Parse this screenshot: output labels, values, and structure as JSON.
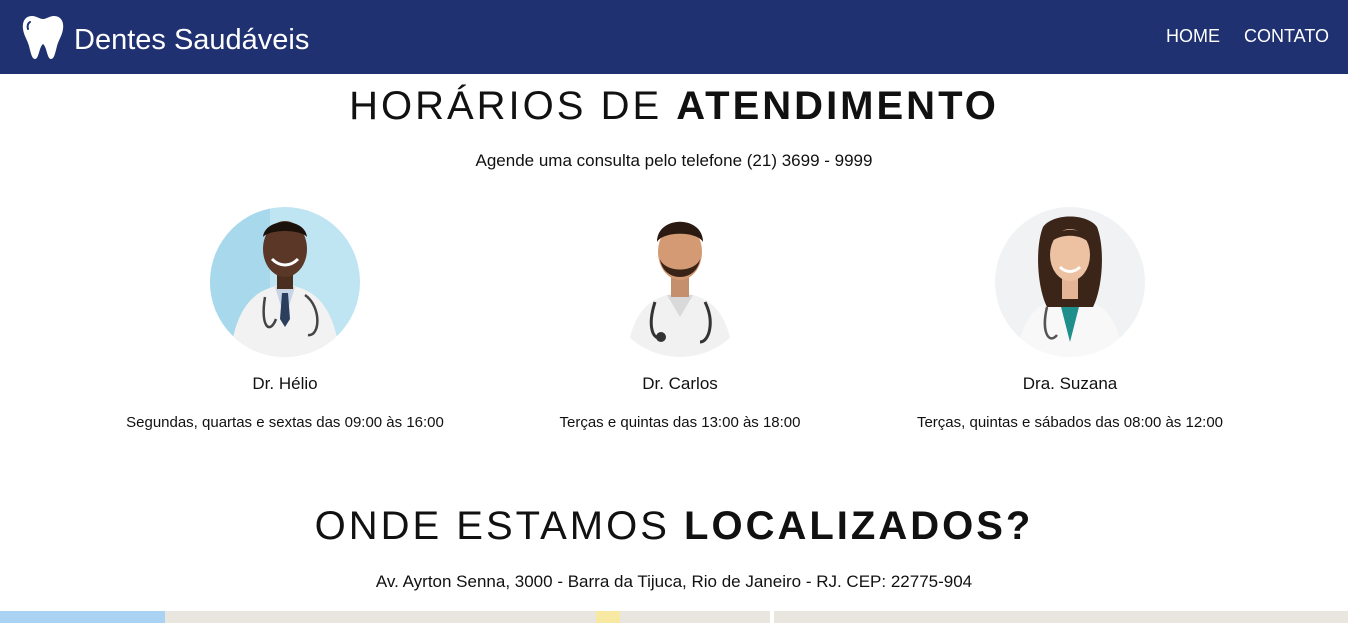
{
  "header": {
    "brand": "Dentes Saudáveis",
    "nav": [
      "HOME",
      "CONTATO"
    ]
  },
  "schedule": {
    "title_light": "HORÁRIOS DE",
    "title_bold": "ATENDIMENTO",
    "subtitle": "Agende uma consulta pelo telefone (21) 3699 - 9999",
    "doctors": [
      {
        "name": "Dr. Hélio",
        "hours": "Segundas, quartas e sextas das 09:00 às 16:00"
      },
      {
        "name": "Dr. Carlos",
        "hours": "Terças e quintas das 13:00 às 18:00"
      },
      {
        "name": "Dra. Suzana",
        "hours": "Terças, quintas e sábados das 08:00 às 12:00"
      }
    ]
  },
  "location": {
    "title_light": "ONDE ESTAMOS",
    "title_bold": "LOCALIZADOS?",
    "address": "Av. Ayrton Senna, 3000 - Barra da Tijuca, Rio de Janeiro - RJ. CEP: 22775-904"
  },
  "colors": {
    "navbar": "#1f3170",
    "map_water": "#a9d2f3"
  },
  "icons": [
    "tooth-icon"
  ]
}
